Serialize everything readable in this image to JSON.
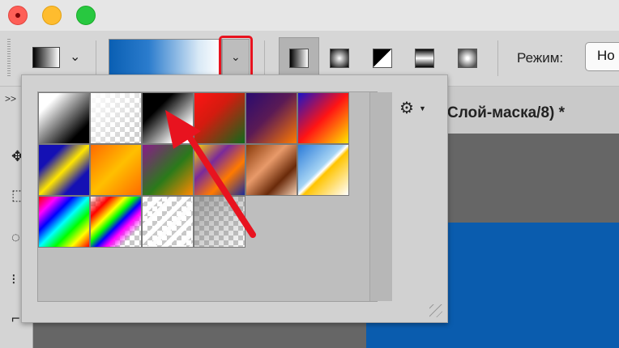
{
  "window": {
    "controls": [
      "close-icon",
      "minimize-icon",
      "zoom-icon"
    ]
  },
  "options_bar": {
    "mode_label": "Режим:",
    "mode_value": "Но",
    "gradient_types": [
      "linear",
      "radial",
      "angle",
      "reflected",
      "diamond"
    ],
    "active_gradient_type": "linear",
    "current_gradient_colors": [
      "#0a5fb3",
      "#ffffff"
    ]
  },
  "document": {
    "tab_title": "Слой-маска/8) *"
  },
  "picker": {
    "settings_icon": "gear-icon",
    "presets": [
      {
        "name": "foreground-to-background",
        "css": "linear-gradient(135deg,#fff 0%,#fff 20%,#000 80%,#000 100%)",
        "checker": false
      },
      {
        "name": "foreground-to-transparent",
        "css": "linear-gradient(135deg,rgba(255,255,255,1) 0%,rgba(255,255,255,0) 100%)",
        "checker": true
      },
      {
        "name": "black-white",
        "css": "linear-gradient(135deg,#000 0%,#000 30%,#fff 80%,#fff 100%)",
        "checker": false
      },
      {
        "name": "red-green",
        "css": "linear-gradient(135deg,#ff1414 0%,#d31b0f 40%,#0f6a1a 100%)",
        "checker": false
      },
      {
        "name": "violet-orange",
        "css": "linear-gradient(135deg,#2a0b70 0%,#5a1a55 45%,#ff7a00 100%)",
        "checker": false
      },
      {
        "name": "blue-red-yellow",
        "css": "linear-gradient(135deg,#1a14c8 0%,#ff1414 50%,#ffe600 100%)",
        "checker": false
      },
      {
        "name": "blue-yellow-blue",
        "css": "linear-gradient(135deg,#1410b4 0%,#1410b4 25%,#ffe600 50%,#1410b4 75%,#1410b4 100%)",
        "checker": false
      },
      {
        "name": "orange-yellow-orange",
        "css": "linear-gradient(135deg,#ff6a00 0%,#ffbf00 50%,#ff6a00 100%)",
        "checker": false
      },
      {
        "name": "violet-green-orange",
        "css": "linear-gradient(135deg,#8a1a8a 0%,#2a7a1a 55%,#ff8a00 100%)",
        "checker": false
      },
      {
        "name": "yellow-violet-orange-blue",
        "css": "linear-gradient(135deg,#ffd400 0%,#7a2a9a 35%,#ff7a00 65%,#1a2a9a 100%)",
        "checker": false
      },
      {
        "name": "copper",
        "css": "linear-gradient(135deg,#8a3a0a 0%,#e89a6a 40%,#6a2a0a 70%,#f4d0b4 100%)",
        "checker": false
      },
      {
        "name": "chrome",
        "css": "linear-gradient(135deg,#2a7ad8 0%,#a6d4f4 45%,#fff 50%,#ffc400 55%,#fff 100%)",
        "checker": false
      },
      {
        "name": "spectrum",
        "css": "linear-gradient(135deg,#ff0000 0%,#ff00ff 18%,#0000ff 34%,#00ffff 50%,#00ff00 66%,#ffff00 82%,#ff0000 100%)",
        "checker": false
      },
      {
        "name": "transparent-rainbow",
        "css": "linear-gradient(135deg,rgba(255,0,0,0) 0%,#ff0000 20%,#ffff00 35%,#00ff00 45%,#0000ff 55%,#ff00ff 65%,rgba(255,0,255,0) 80%)",
        "checker": true
      },
      {
        "name": "transparent-stripes",
        "css": "repeating-linear-gradient(135deg,rgba(255,255,255,0.95) 0 6px,rgba(255,255,255,0) 6px 12px)",
        "checker": true
      },
      {
        "name": "neutral-density",
        "css": "linear-gradient(135deg,rgba(120,120,120,0.7) 0%,rgba(120,120,120,0) 100%)",
        "checker": true
      }
    ]
  }
}
